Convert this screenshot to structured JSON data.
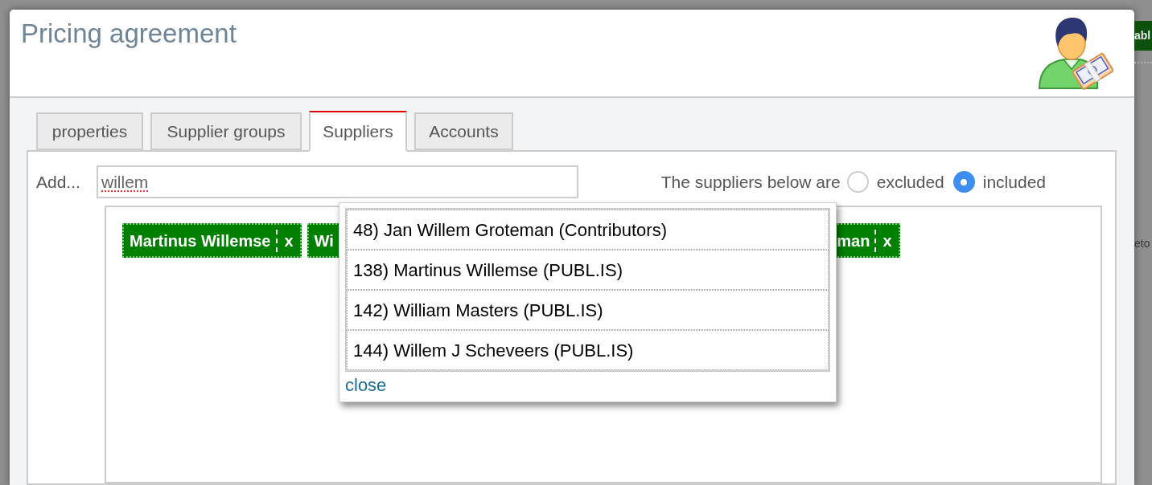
{
  "background": {
    "button_fragment": "abl",
    "text_fragment": "eto"
  },
  "dialog": {
    "title": "Pricing agreement"
  },
  "tabs": [
    {
      "label": "properties",
      "selected": false
    },
    {
      "label": "Supplier groups",
      "selected": false
    },
    {
      "label": "Suppliers",
      "selected": true
    },
    {
      "label": "Accounts",
      "selected": false
    }
  ],
  "add_field": {
    "label": "Add...",
    "value": "willem",
    "spelling_flagged": true
  },
  "mode": {
    "label": "The suppliers below are",
    "options": [
      {
        "label": "excluded",
        "selected": false
      },
      {
        "label": "included",
        "selected": true
      }
    ]
  },
  "tags": [
    {
      "label": "Martinus Willemse",
      "remove": "x"
    },
    {
      "label": "Wi"
    },
    {
      "label": "man",
      "remove": "x"
    }
  ],
  "suggestions": {
    "items": [
      "48) Jan Willem Groteman (Contributors)",
      "138) Martinus Willemse (PUBL.IS)",
      "142) William Masters (PUBL.IS)",
      "144) Willem J Scheveers (PUBL.IS)"
    ],
    "close_link": "close"
  }
}
